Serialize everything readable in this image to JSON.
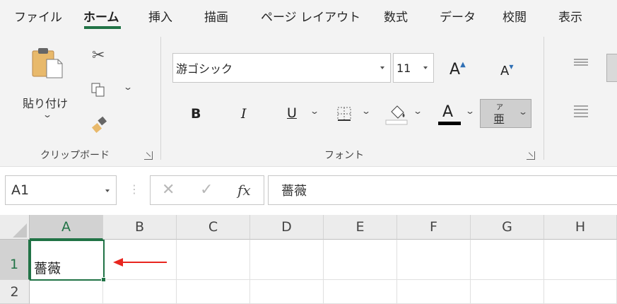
{
  "menu": {
    "tabs": [
      {
        "label": "ファイル"
      },
      {
        "label": "ホーム"
      },
      {
        "label": "挿入"
      },
      {
        "label": "描画"
      },
      {
        "label": "ページ レイアウト"
      },
      {
        "label": "数式"
      },
      {
        "label": "データ"
      },
      {
        "label": "校閲"
      },
      {
        "label": "表示"
      }
    ],
    "active_tab": "ホーム"
  },
  "ribbon": {
    "clipboard": {
      "paste_label": "貼り付け",
      "group_label": "クリップボード"
    },
    "font": {
      "font_name": "游ゴシック",
      "font_size": "11",
      "bold_label": "B",
      "italic_label": "I",
      "underline_label": "U",
      "font_color_label": "A",
      "phonetic_top": "ア",
      "phonetic_bottom": "亜",
      "group_label": "フォント"
    }
  },
  "formula_bar": {
    "name_box": "A1",
    "fx_label": "fx",
    "formula": "薔薇"
  },
  "sheet": {
    "columns": [
      "A",
      "B",
      "C",
      "D",
      "E",
      "F",
      "G",
      "H"
    ],
    "rows": [
      "1",
      "2"
    ],
    "selected_cell": "A1",
    "cells": {
      "A1": "薔薇"
    }
  },
  "colors": {
    "accent": "#217346",
    "arrow": "#e8261f",
    "font_color_bar": "#000000"
  }
}
